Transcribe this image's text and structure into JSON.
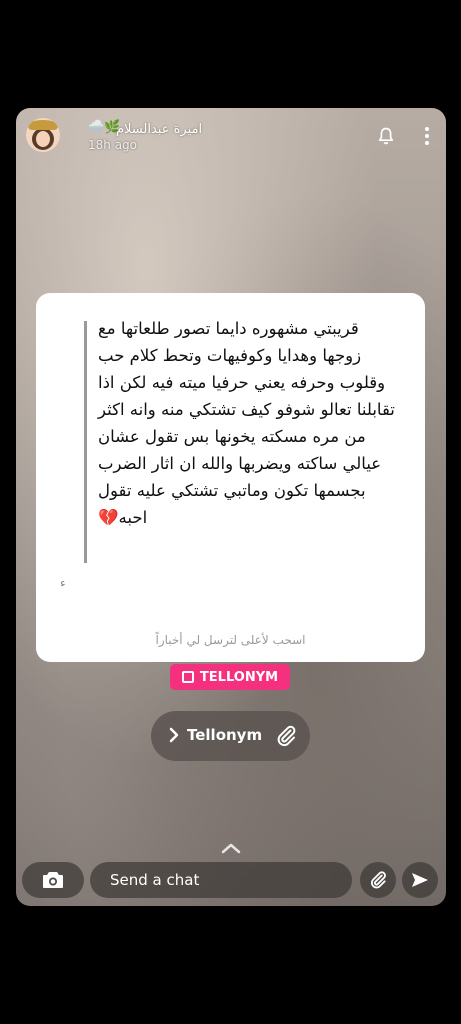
{
  "header": {
    "user_name": "اميرة عبدالسلام",
    "weather_emoji": "🌨️🌿",
    "time_ago": "18h ago"
  },
  "card": {
    "message": "قريبتي مشهوره دايما تصور طلعاتها مع زوجها وهدايا وكوفيهات وتحط كلام حب وقلوب وحرفه يعني حرفيا ميته فيه لكن اذا تقابلنا تعالو شوفو كيف تشتكي منه وانه اكثر من مره مسكته يخونها بس تقول عشان عيالي ساكته ويضربها والله ان اثار الضرب بجسمها تكون وماتبي تشتكي عليه تقول احبه💔",
    "dot": "ء",
    "swipe_hint": "اسحب لأعلى لترسل لي أخباراً"
  },
  "brand_badge": {
    "label": "TELLONYM",
    "color": "#f5317f"
  },
  "link_pill": {
    "label": "Tellonym"
  },
  "bottom_bar": {
    "chat_placeholder": "Send a chat"
  },
  "icons": [
    "bell-icon",
    "more-icon",
    "chevron-right-icon",
    "paperclip-icon",
    "chevron-up-icon",
    "camera-icon",
    "send-icon"
  ]
}
